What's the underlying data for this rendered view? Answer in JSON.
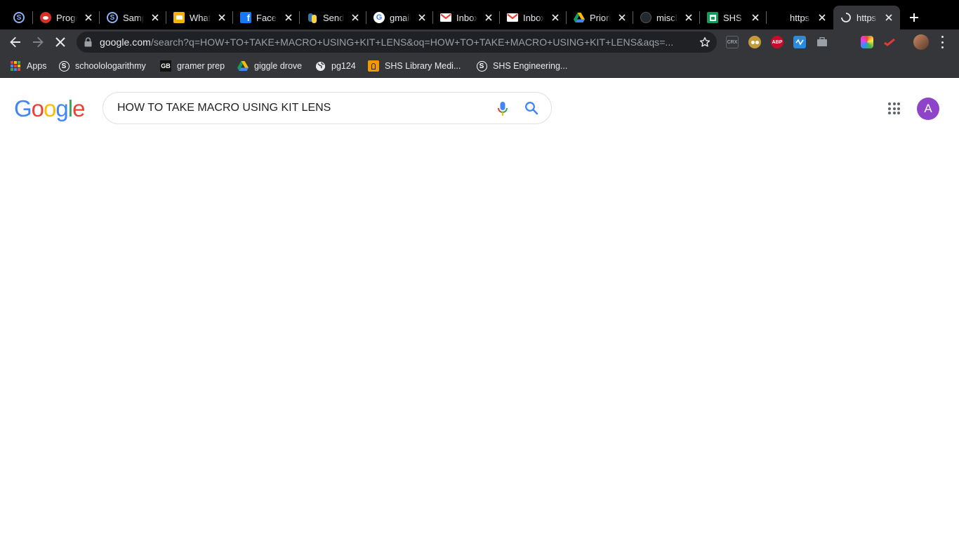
{
  "browser": {
    "tabs": [
      {
        "title": "",
        "favicon": "schoology-icon",
        "color": "#1a73e8"
      },
      {
        "title": "Progr",
        "favicon": "reddit-icon",
        "color": "#d93025"
      },
      {
        "title": "Samp",
        "favicon": "schoology-icon",
        "color": "#1a73e8"
      },
      {
        "title": "What",
        "favicon": "slides-icon",
        "color": "#f4b400"
      },
      {
        "title": "Faceb",
        "favicon": "facebook-icon",
        "color": "#1877f2"
      },
      {
        "title": "Sendi",
        "favicon": "python-icon",
        "color": "#3776ab"
      },
      {
        "title": "gmail",
        "favicon": "google-icon",
        "color": "#ffffff"
      },
      {
        "title": "Inbox",
        "favicon": "gmail-icon",
        "color": "#ffffff"
      },
      {
        "title": "Inbox",
        "favicon": "gmail-icon",
        "color": "#ffffff"
      },
      {
        "title": "Priori",
        "favicon": "drive-icon",
        "color": "#0f9d58"
      },
      {
        "title": "misch",
        "favicon": "github-icon",
        "color": "#24292e"
      },
      {
        "title": "SHS I",
        "favicon": "sheets-icon",
        "color": "#0f9d58"
      },
      {
        "title": "https",
        "favicon": "blank-icon",
        "color": "#000000"
      },
      {
        "title": "https",
        "favicon": "loading-spinner-icon",
        "color": "#e8eaed"
      }
    ],
    "new_tab_label": "+",
    "address": {
      "host": "google.com",
      "path": "/search?q=HOW+TO+TAKE+MACRO+USING+KIT+LENS&oq=HOW+TO+TAKE+MACRO+USING+KIT+LENS&aqs=..."
    },
    "extensions": [
      {
        "name": "crx-icon",
        "label": "CRX",
        "color": "#5f6368"
      },
      {
        "name": "owl-icon",
        "label": "",
        "color": "#c49a3a"
      },
      {
        "name": "adblock-plus-icon",
        "label": "ABP",
        "color": "#c70d2c"
      },
      {
        "name": "wave-icon",
        "label": "",
        "color": "#2b8ad9"
      },
      {
        "name": "briefcase-icon",
        "label": "",
        "color": "#9aa0a6"
      },
      {
        "name": "hidden-extension-icon",
        "label": "",
        "color": "#35363a"
      },
      {
        "name": "colorful-extension-icon",
        "label": "",
        "color": "#e040fb"
      },
      {
        "name": "red-check-icon",
        "label": "",
        "color": "#e53935"
      }
    ],
    "bookmarks": [
      {
        "name": "bookmark-apps",
        "icon": "apps-grid-icon",
        "label": "Apps"
      },
      {
        "name": "bookmark-schoolologarithmy",
        "icon": "schoology-icon",
        "label": "schoolologarithmy"
      },
      {
        "name": "bookmark-gramer-prep",
        "icon": "gb-icon",
        "label": "gramer prep"
      },
      {
        "name": "bookmark-giggle-drove",
        "icon": "drive-icon",
        "label": "giggle drove"
      },
      {
        "name": "bookmark-pg124",
        "icon": "globe-icon",
        "label": "pg124"
      },
      {
        "name": "bookmark-shs-library",
        "icon": "library-icon",
        "label": "SHS Library Medi..."
      },
      {
        "name": "bookmark-shs-engineering",
        "icon": "schoology-icon",
        "label": "SHS Engineering..."
      }
    ]
  },
  "page": {
    "logo": [
      "G",
      "o",
      "o",
      "g",
      "l",
      "e"
    ],
    "logo_colors": [
      "#4285f4",
      "#ea4335",
      "#fbbc05",
      "#4285f4",
      "#34a853",
      "#ea4335"
    ],
    "search_query": "HOW TO TAKE MACRO USING KIT LENS",
    "avatar_letter": "A",
    "avatar_color": "#8e44c8"
  }
}
